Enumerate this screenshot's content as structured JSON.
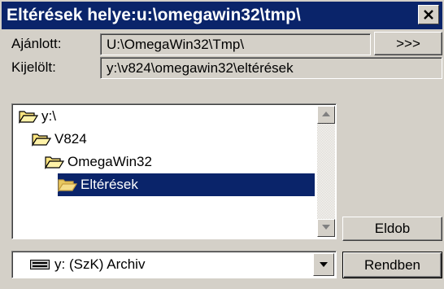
{
  "window": {
    "title": "Eltérések helye:u:\\omegawin32\\tmp\\"
  },
  "recommended": {
    "label": "Ajánlott:",
    "value": "U:\\OmegaWin32\\Tmp\\",
    "button_label": ">>>"
  },
  "selected": {
    "label": "Kijelölt:",
    "value": "y:\\v824\\omegawin32\\eltérések"
  },
  "tree": {
    "items": [
      {
        "label": "y:\\",
        "level": 0,
        "selected": false
      },
      {
        "label": "V824",
        "level": 1,
        "selected": false
      },
      {
        "label": "OmegaWin32",
        "level": 2,
        "selected": false
      },
      {
        "label": "Eltérések",
        "level": 3,
        "selected": true
      }
    ]
  },
  "drive": {
    "value": "y: (SzK) Archiv",
    "icon": "drive-icon"
  },
  "buttons": {
    "discard_label": "Eldob",
    "ok_label": "Rendben"
  },
  "colors": {
    "titlebar": "#0a246a",
    "selection": "#0a246a",
    "face": "#d4d0c8"
  }
}
